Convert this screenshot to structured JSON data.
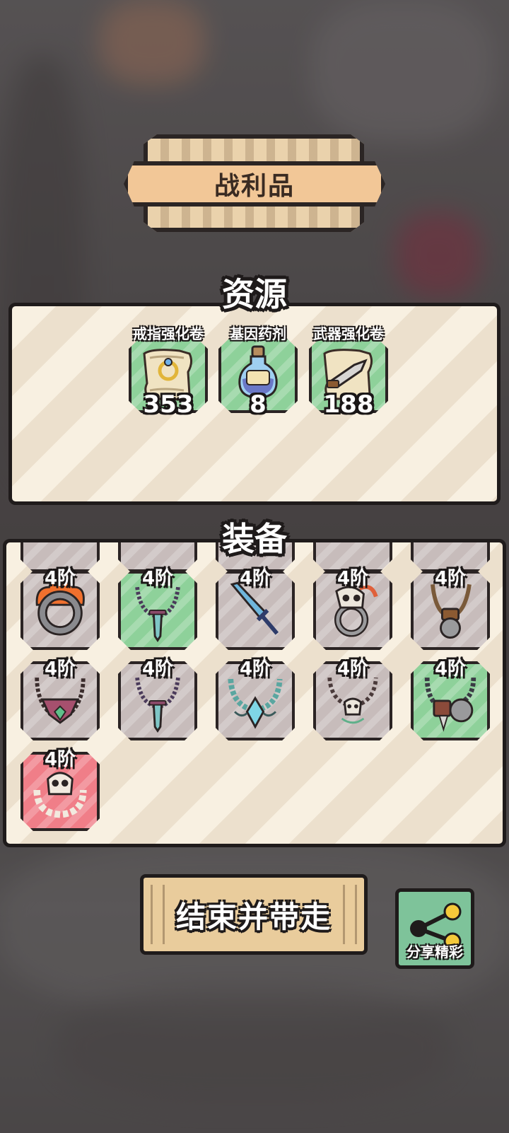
{
  "title": "战利品",
  "resources_header": "资源",
  "equipment_header": "装备",
  "resources": [
    {
      "label": "戒指强化卷",
      "count": "353",
      "icon": "ring-scroll-icon"
    },
    {
      "label": "基因药剂",
      "count": "8",
      "icon": "potion-bottle-icon"
    },
    {
      "label": "武器强化卷",
      "count": "188",
      "icon": "weapon-scroll-icon"
    }
  ],
  "equipment": [
    {
      "tier": "4阶",
      "icon": "flame-ring-icon",
      "rarity": "gray"
    },
    {
      "tier": "4阶",
      "icon": "sword-necklace-icon",
      "rarity": "green"
    },
    {
      "tier": "4阶",
      "icon": "blue-sword-icon",
      "rarity": "gray"
    },
    {
      "tier": "4阶",
      "icon": "skull-ring-icon",
      "rarity": "gray"
    },
    {
      "tier": "4阶",
      "icon": "sawblade-pendant-icon",
      "rarity": "gray"
    },
    {
      "tier": "4阶",
      "icon": "gem-necklace-icon",
      "rarity": "gray"
    },
    {
      "tier": "4阶",
      "icon": "sword-necklace-icon",
      "rarity": "gray"
    },
    {
      "tier": "4阶",
      "icon": "jade-necklace-icon",
      "rarity": "gray"
    },
    {
      "tier": "4阶",
      "icon": "bone-skull-necklace-icon",
      "rarity": "gray"
    },
    {
      "tier": "4阶",
      "icon": "gear-necklace-icon",
      "rarity": "green"
    },
    {
      "tier": "4阶",
      "icon": "skull-bone-necklace-icon",
      "rarity": "red"
    }
  ],
  "buttons": {
    "end_label": "结束并带走",
    "share_label": "分享精彩"
  },
  "colors": {
    "panel_bg": "#f8f0e1",
    "green_tile": "#8ed19a",
    "gray_tile": "#c7bcbb",
    "red_tile": "#f07e88",
    "button_tan": "#e9cc9c",
    "share_green": "#7ec39a"
  }
}
